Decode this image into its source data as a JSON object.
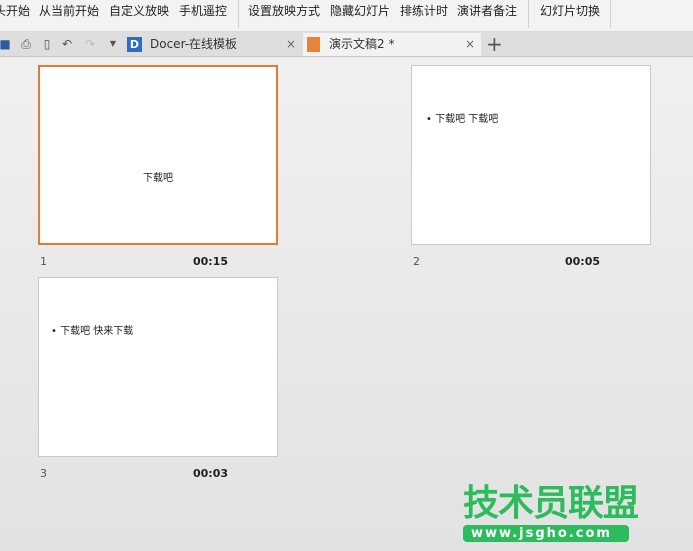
{
  "ribbon": {
    "items": [
      "头开始",
      "从当前开始",
      "自定义放映",
      "手机遥控",
      "设置放映方式",
      "隐藏幻灯片",
      "排练计时",
      "演讲者备注",
      "幻灯片切换"
    ]
  },
  "tabs": [
    {
      "label": "Docer-在线模板",
      "close": "×"
    },
    {
      "label": "演示文稿2 *",
      "close": "×"
    }
  ],
  "new_tab": "+",
  "slides": [
    {
      "number": "1",
      "time": "00:15",
      "text": "下载吧",
      "selected": true
    },
    {
      "number": "2",
      "time": "00:05",
      "text": "• 下载吧  下载吧"
    },
    {
      "number": "3",
      "time": "00:03",
      "text": "• 下载吧  快来下载"
    }
  ],
  "watermark": {
    "title": "技术员联盟",
    "url": "www.jsgho.com",
    "color": "#2dbb5d"
  }
}
